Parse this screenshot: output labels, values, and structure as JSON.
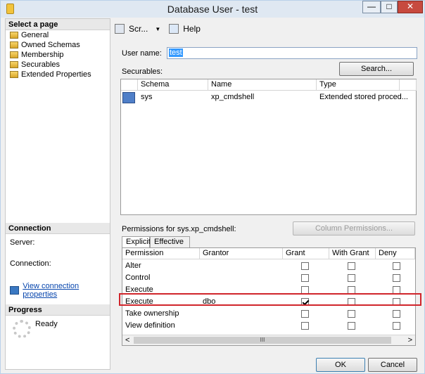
{
  "window": {
    "title": "Database User - test",
    "min": "—",
    "max": "□",
    "close": "✕"
  },
  "left": {
    "select_page_header": "Select a page",
    "pages": [
      "General",
      "Owned Schemas",
      "Membership",
      "Securables",
      "Extended Properties"
    ],
    "connection_header": "Connection",
    "server_label": "Server:",
    "server_value": "",
    "connection_label": "Connection:",
    "connection_value": "",
    "view_conn_link": "View connection properties",
    "progress_header": "Progress",
    "progress_status": "Ready"
  },
  "toolbar": {
    "script_label": "Scr...",
    "script_arrow": "▼",
    "help_label": "Help"
  },
  "main": {
    "user_name_label": "User name:",
    "user_name_value": "test",
    "securables_label": "Securables:",
    "search_button": "Search...",
    "securables_columns": [
      "Schema",
      "Name",
      "Type"
    ],
    "securables_rows": [
      {
        "schema": "sys",
        "name": "xp_cmdshell",
        "type": "Extended stored proced..."
      }
    ],
    "permissions_label": "Permissions for sys.xp_cmdshell:",
    "column_permissions_button": "Column Permissions...",
    "tabs": [
      "Explicit",
      "Effective"
    ],
    "perm_columns": [
      "Permission",
      "Grantor",
      "Grant",
      "With Grant",
      "Deny"
    ],
    "perm_rows": [
      {
        "permission": "Alter",
        "grantor": "",
        "grant": false,
        "with_grant": false,
        "deny": false
      },
      {
        "permission": "Control",
        "grantor": "",
        "grant": false,
        "with_grant": false,
        "deny": false
      },
      {
        "permission": "Execute",
        "grantor": "",
        "grant": false,
        "with_grant": false,
        "deny": false
      },
      {
        "permission": "Execute",
        "grantor": "dbo",
        "grant": true,
        "with_grant": false,
        "deny": false
      },
      {
        "permission": "Take ownership",
        "grantor": "",
        "grant": false,
        "with_grant": false,
        "deny": false
      },
      {
        "permission": "View definition",
        "grantor": "",
        "grant": false,
        "with_grant": false,
        "deny": false
      }
    ],
    "scroll_thumb": "III",
    "scroll_left": "<",
    "scroll_right": ">"
  },
  "footer": {
    "ok_button": "OK",
    "cancel_button": "Cancel"
  },
  "colors": {
    "highlight": "#d0252b",
    "titlebar": "#dfe8f2"
  }
}
